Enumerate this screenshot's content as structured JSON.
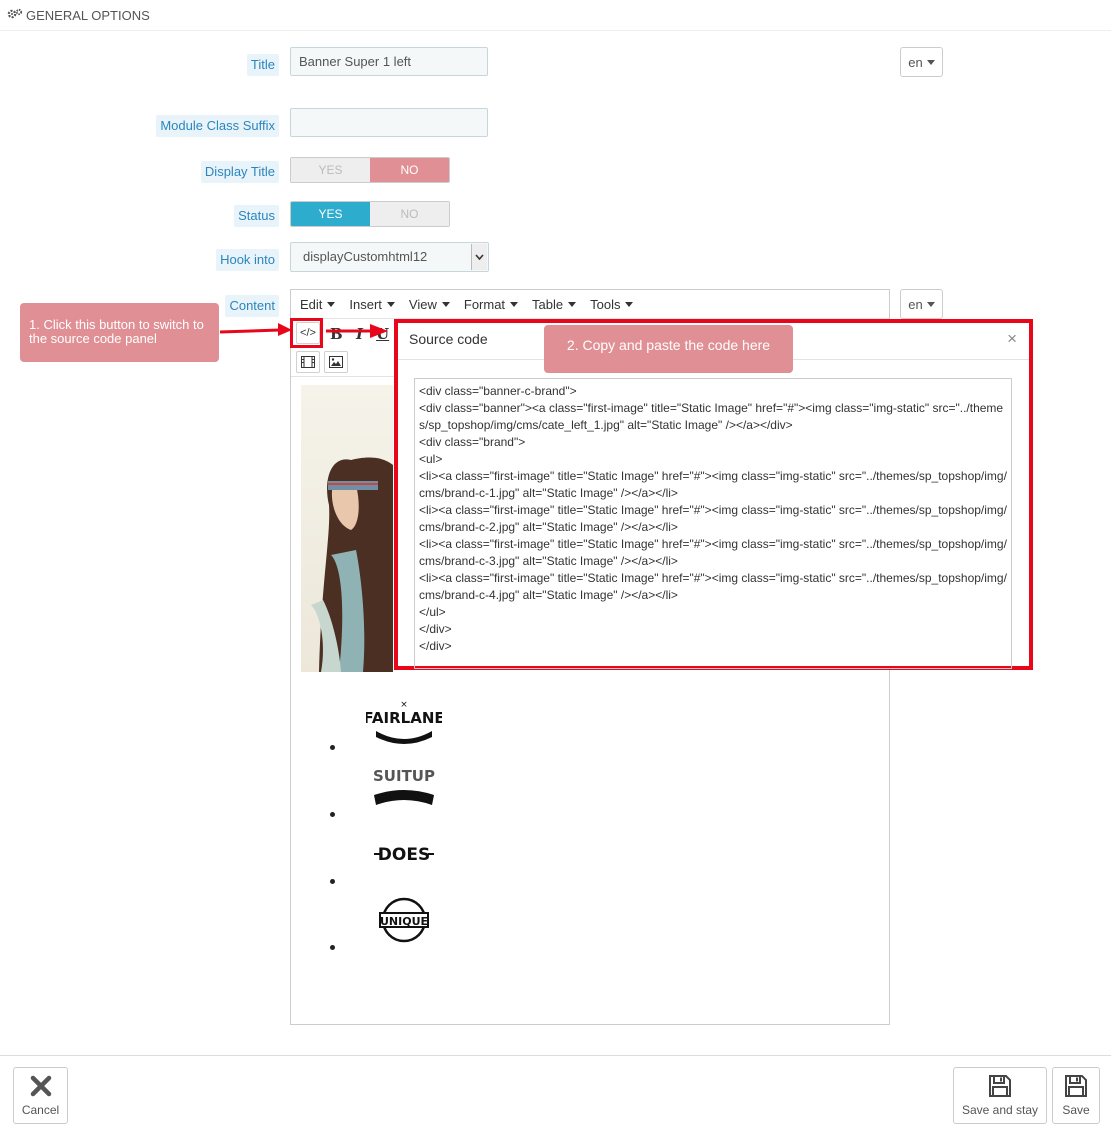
{
  "section": {
    "title": "GENERAL OPTIONS",
    "icon": "gears-icon"
  },
  "form": {
    "title": {
      "label": "Title",
      "value": "Banner Super 1 left",
      "lang": "en"
    },
    "suffix": {
      "label": "Module Class Suffix",
      "value": ""
    },
    "display_title": {
      "label": "Display Title",
      "yes": "YES",
      "no": "NO",
      "selected": "NO"
    },
    "status": {
      "label": "Status",
      "yes": "YES",
      "no": "NO",
      "selected": "YES"
    },
    "hook": {
      "label": "Hook into",
      "selected": "displayCustomhtml12"
    },
    "content": {
      "label": "Content",
      "lang": "en"
    }
  },
  "editor": {
    "menus": [
      "Edit",
      "Insert",
      "View",
      "Format",
      "Table",
      "Tools"
    ],
    "toolbar": {
      "source_code_icon": "</>",
      "bold": "B",
      "italic": "I",
      "underline": "U"
    }
  },
  "source_modal": {
    "title": "Source code",
    "close": "×",
    "code": "<div class=\"banner-c-brand\">\n<div class=\"banner\"><a class=\"first-image\" title=\"Static Image\" href=\"#\"><img class=\"img-static\" src=\"../themes/sp_topshop/img/cms/cate_left_1.jpg\" alt=\"Static Image\" /></a></div>\n<div class=\"brand\">\n<ul>\n<li><a class=\"first-image\" title=\"Static Image\" href=\"#\"><img class=\"img-static\" src=\"../themes/sp_topshop/img/cms/brand-c-1.jpg\" alt=\"Static Image\" /></a></li>\n<li><a class=\"first-image\" title=\"Static Image\" href=\"#\"><img class=\"img-static\" src=\"../themes/sp_topshop/img/cms/brand-c-2.jpg\" alt=\"Static Image\" /></a></li>\n<li><a class=\"first-image\" title=\"Static Image\" href=\"#\"><img class=\"img-static\" src=\"../themes/sp_topshop/img/cms/brand-c-3.jpg\" alt=\"Static Image\" /></a></li>\n<li><a class=\"first-image\" title=\"Static Image\" href=\"#\"><img class=\"img-static\" src=\"../themes/sp_topshop/img/cms/brand-c-4.jpg\" alt=\"Static Image\" /></a></li>\n</ul>\n</div>\n</div>"
  },
  "callouts": {
    "step1": "1. Click this button to switch to the source code panel",
    "step2": "2. Copy and paste the code here"
  },
  "brands": [
    "FAIRLANE",
    "SUITUP",
    "DOES",
    "UNIQUE"
  ],
  "footer": {
    "cancel": "Cancel",
    "save_and_stay": "Save and stay",
    "save": "Save"
  },
  "colors": {
    "accent_blue": "#2eacce",
    "no_red": "#e08f95",
    "highlight_red": "#e8061a"
  }
}
